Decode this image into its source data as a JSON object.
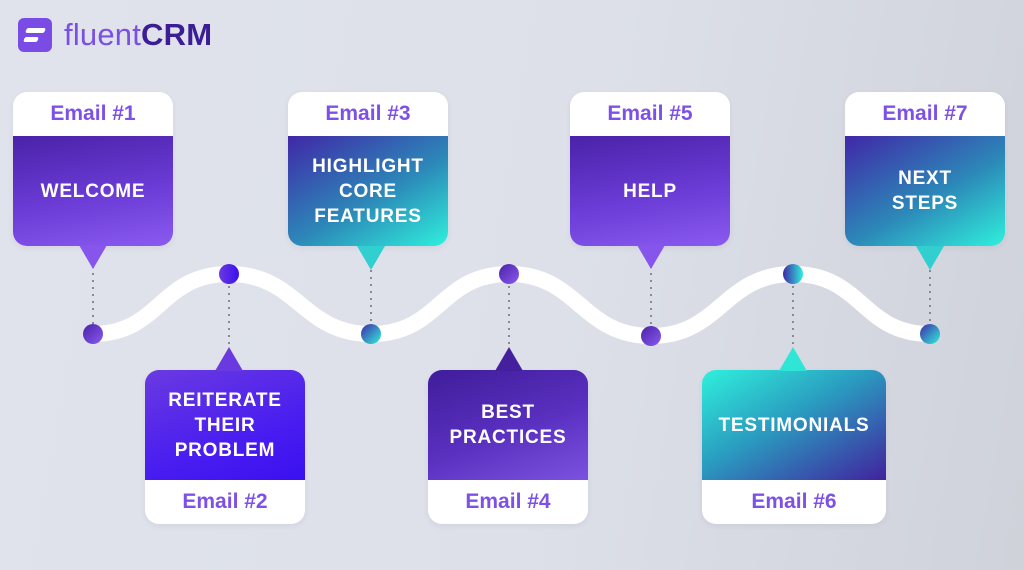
{
  "brand": {
    "name_light": "fluent",
    "name_bold": "CRM",
    "icon": "fluentcrm-logo-icon",
    "color": "#7b4be6"
  },
  "sequence": [
    {
      "label": "Email #1",
      "title": [
        "WELCOME"
      ],
      "position": "top",
      "gradient": "purple"
    },
    {
      "label": "Email #2",
      "title": [
        "REITERATE",
        "THEIR",
        "PROBLEM"
      ],
      "position": "bottom",
      "gradient": "blue"
    },
    {
      "label": "Email #3",
      "title": [
        "HIGHLIGHT",
        "CORE",
        "FEATURES"
      ],
      "position": "top",
      "gradient": "teal"
    },
    {
      "label": "Email #4",
      "title": [
        "BEST",
        "PRACTICES"
      ],
      "position": "bottom",
      "gradient": "deep-purple"
    },
    {
      "label": "Email #5",
      "title": [
        "HELP"
      ],
      "position": "top",
      "gradient": "purple"
    },
    {
      "label": "Email #6",
      "title": [
        "TESTIMONIALS"
      ],
      "position": "bottom",
      "gradient": "teal-reverse"
    },
    {
      "label": "Email #7",
      "title": [
        "NEXT",
        "STEPS"
      ],
      "position": "top",
      "gradient": "teal"
    }
  ],
  "colors": {
    "label_text": "#7e51e6",
    "path": "#ffffff",
    "connector": "#8a8a96",
    "background": "#dfe2ea"
  }
}
